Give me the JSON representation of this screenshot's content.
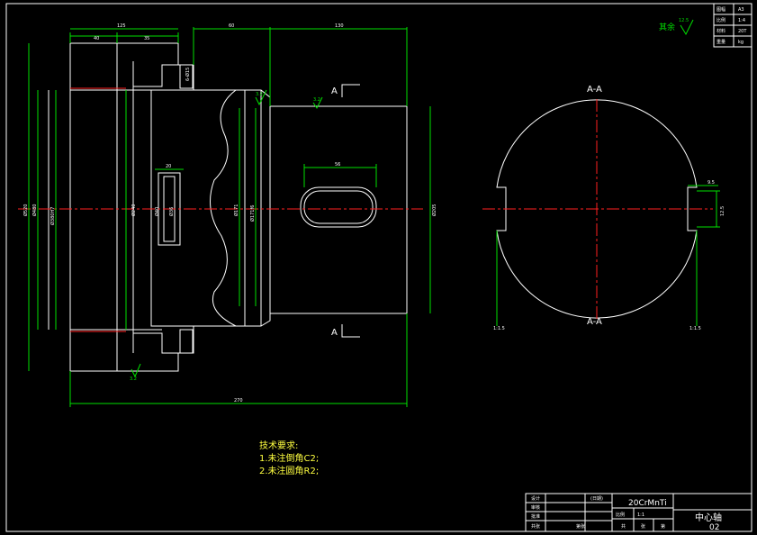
{
  "colors": {
    "background": "#000000",
    "outline": "#ffffff",
    "dimension": "#00e000",
    "center_line": "#ff2020",
    "hatch": "#00e000"
  },
  "section_labels": {
    "cut_top": "A",
    "cut_bottom": "A",
    "view_title": "A-A"
  },
  "roughness": {
    "rest": "其余",
    "rest_value": "12.5",
    "mark_a": "3.2",
    "mark_b": "3.2",
    "mark_c": "3.2"
  },
  "dimensions": {
    "top_40": "40",
    "top_35": "35",
    "top_125": "125",
    "top_60": "60",
    "top_130": "130",
    "bottom_270": "270",
    "slot_56": "56",
    "bore_a": "Ø520",
    "bore_b": "Ø480",
    "bore_c": "Ø380H7",
    "hub_d": "Ø240",
    "keyhole_w": "20",
    "keyhole_h": "14",
    "keyhole_d1": "Ø40",
    "keyhole_d2": "Ø36",
    "neck_d": "Ø171",
    "neck_d2": "Ø171f6",
    "shaft_d": "Ø205",
    "side_small": "6-Ø15",
    "key_w": "9.5",
    "key_h": "12.5",
    "sec_left": "1:1.5",
    "sec_right": "1:1.5"
  },
  "notes": {
    "title": "技术要求:",
    "line1": "1.未注倒角C2;",
    "line2": "2.未注圆角R2;"
  },
  "title_block_top": {
    "rows": [
      {
        "label": "图幅",
        "value": "A3"
      },
      {
        "label": "比例",
        "value": "1:4"
      },
      {
        "label": "材料",
        "value": "20T"
      },
      {
        "label": "重量",
        "value": "kg"
      }
    ]
  },
  "title_block": {
    "material": "20CrMnTi",
    "name": "中心轴",
    "number": "02",
    "scale_label": "比例",
    "scale": "1:1",
    "design": "设计",
    "check": "审核",
    "approve": "批准",
    "date": "(日期)",
    "sheet": "共张",
    "sheet_of": "第张",
    "footer_a": "共",
    "footer_b": "张",
    "footer_c": "第"
  }
}
